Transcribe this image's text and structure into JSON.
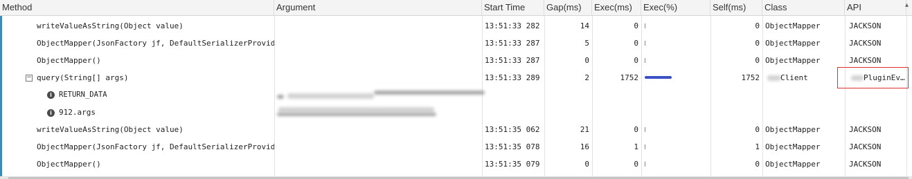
{
  "headers": [
    "Method",
    "Argument",
    "Start Time",
    "Gap(ms)",
    "Exec(ms)",
    "Exec(%)",
    "Self(ms)",
    "Class",
    "API"
  ],
  "rows": [
    {
      "method": "writeValueAsString(Object value)",
      "start": "13:51:33 282",
      "gap": "14",
      "exec": "0",
      "self": "0",
      "class": "ObjectMapper",
      "api": "JACKSON"
    },
    {
      "method": "ObjectMapper(JsonFactory jf, DefaultSerializerProvid",
      "start": "13:51:33 287",
      "gap": "5",
      "exec": "0",
      "self": "0",
      "class": "ObjectMapper",
      "api": "JACKSON"
    },
    {
      "method": "ObjectMapper()",
      "start": "13:51:33 287",
      "gap": "0",
      "exec": "0",
      "self": "0",
      "class": "ObjectMapper",
      "api": "JACKSON"
    },
    {
      "method": "query(String[] args)",
      "start": "13:51:33 289",
      "gap": "2",
      "exec": "1752",
      "self": "1752",
      "class": "Client",
      "api": "PluginEv…",
      "exec_percent": 100
    },
    {
      "method": "RETURN_DATA"
    },
    {
      "method": "912.args"
    },
    {
      "method": "writeValueAsString(Object value)",
      "start": "13:51:35 062",
      "gap": "21",
      "exec": "0",
      "self": "0",
      "class": "ObjectMapper",
      "api": "JACKSON"
    },
    {
      "method": "ObjectMapper(JsonFactory jf, DefaultSerializerProvid",
      "start": "13:51:35 078",
      "gap": "16",
      "exec": "1",
      "self": "1",
      "class": "ObjectMapper",
      "api": "JACKSON"
    },
    {
      "method": "ObjectMapper()",
      "start": "13:51:35 079",
      "gap": "0",
      "exec": "0",
      "self": "0",
      "class": "ObjectMapper",
      "api": "JACKSON"
    }
  ],
  "colors": {
    "accent": "#3a8bb8",
    "exec_bar": "#3a52c4",
    "highlight_border": "#e03030"
  }
}
